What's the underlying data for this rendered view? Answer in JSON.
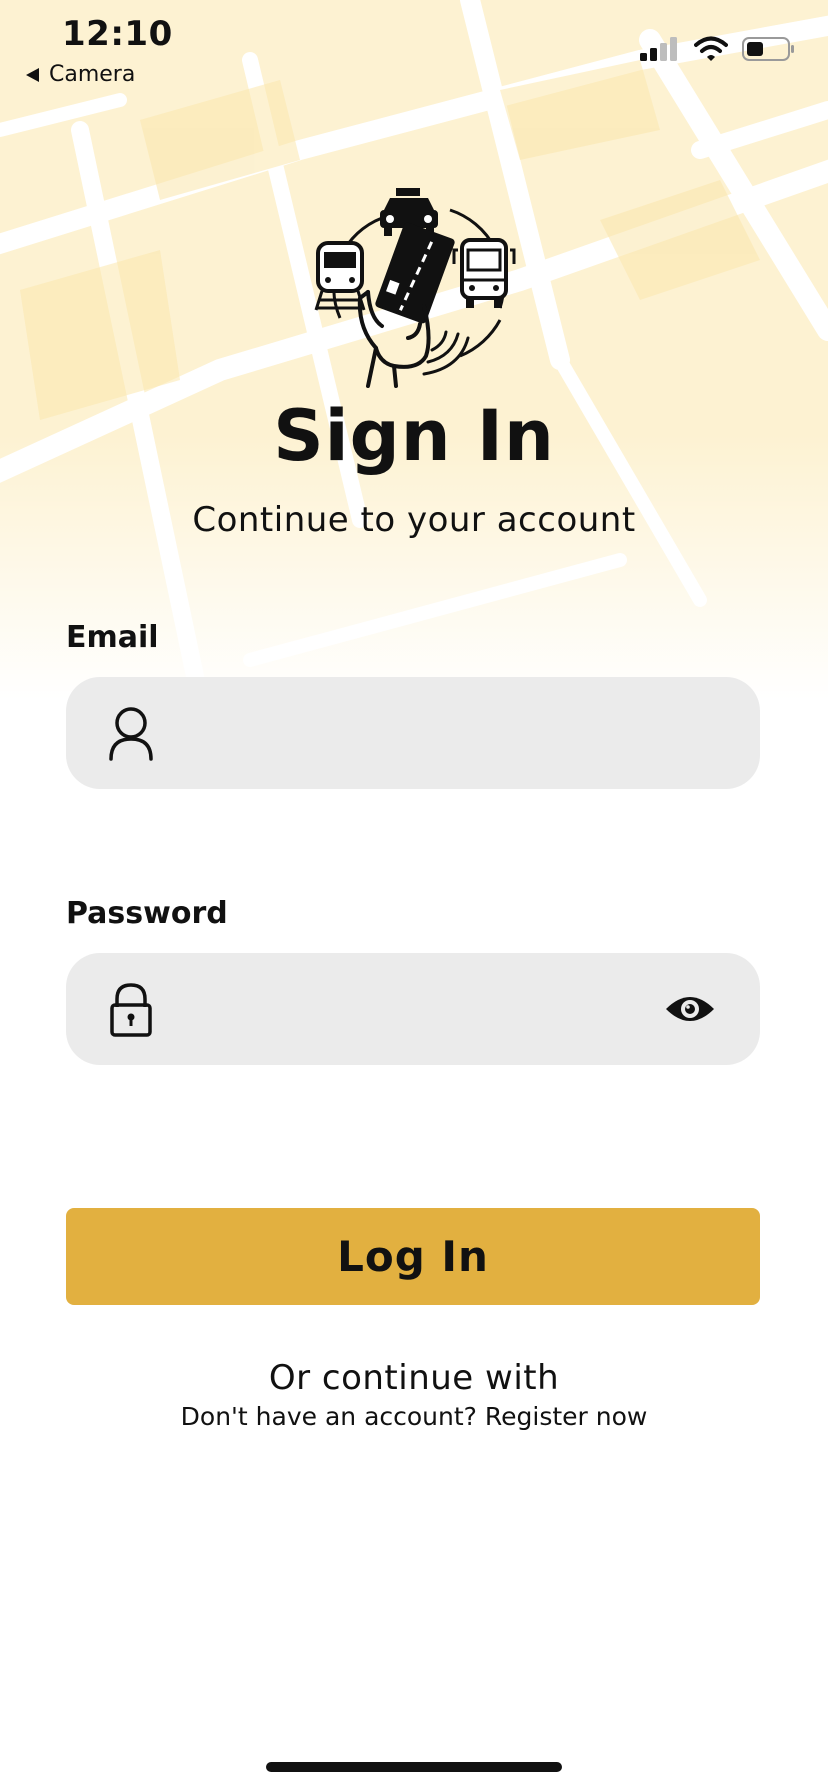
{
  "status_bar": {
    "time": "12:10",
    "back_app": "Camera"
  },
  "header": {
    "logo_icon": "transit-payment-logo-icon",
    "title": "Sign In",
    "subtitle": "Continue to your account"
  },
  "form": {
    "email_label": "Email",
    "email_value": "",
    "email_placeholder": "",
    "password_label": "Password",
    "password_value": "",
    "password_placeholder": ""
  },
  "actions": {
    "login_label": "Log In",
    "or_text": "Or continue with",
    "register_text": "Don't have an account? Register now"
  },
  "colors": {
    "accent": "#e2b040",
    "field_bg": "#ebebeb",
    "map_tint": "#fdf0c8"
  }
}
